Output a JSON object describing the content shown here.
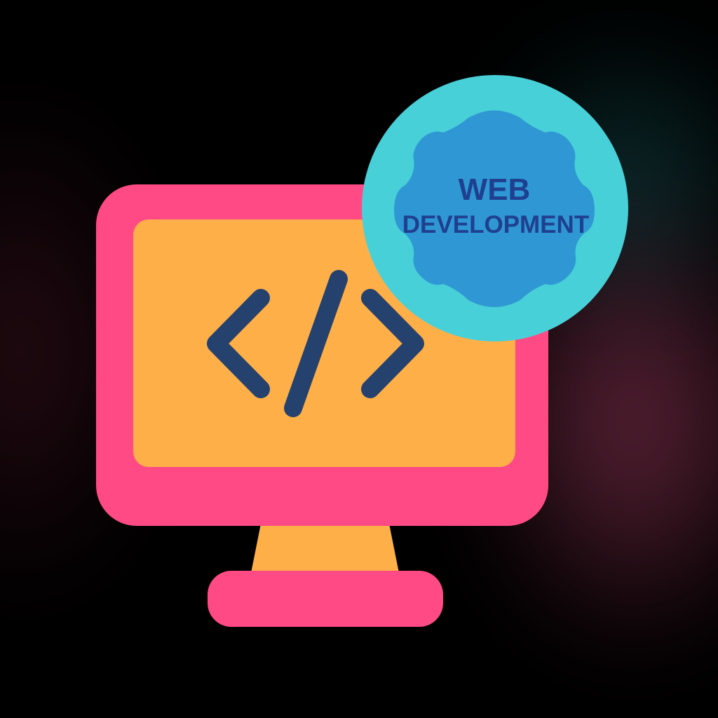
{
  "badge": {
    "line1": "WEB",
    "line2": "DEVELOPMENT"
  },
  "icons": {
    "monitor": "monitor-icon",
    "code": "code-brackets-icon",
    "gear": "gear-icon"
  },
  "colors": {
    "background": "#000000",
    "monitor_frame": "#ff4a86",
    "monitor_screen": "#ffaf47",
    "code_symbol": "#25426f",
    "badge_circle": "#48d0d8",
    "gear": "#2f98d4",
    "badge_text": "#1f3f8f"
  }
}
